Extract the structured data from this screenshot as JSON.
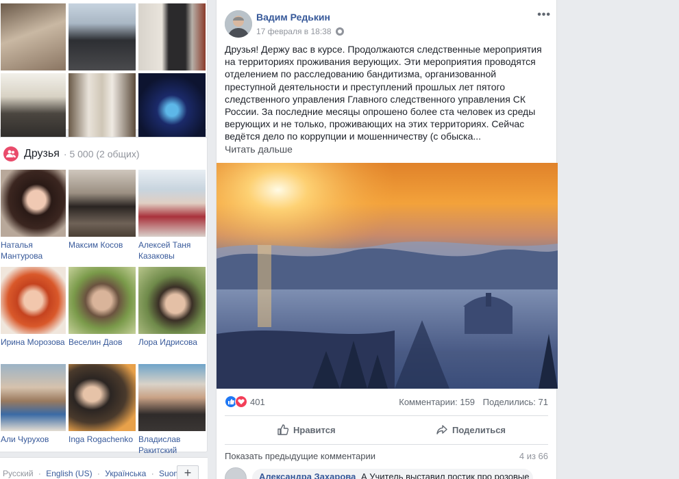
{
  "photos": {
    "tiles": [
      "photo-dinner",
      "photo-group",
      "photo-church-man",
      "photo-hall",
      "photo-two-men",
      "photo-stage"
    ]
  },
  "friends": {
    "title": "Друзья",
    "count": "· 5 000 (2 общих)",
    "items": [
      {
        "name_line1": "Наталья",
        "name_line2": "Мантурова"
      },
      {
        "name_line1": "Максим Косов",
        "name_line2": ""
      },
      {
        "name_line1": "Алексей Таня",
        "name_line2": "Казаковы"
      },
      {
        "name_line1": "Ирина Морозова",
        "name_line2": ""
      },
      {
        "name_line1": "Веселин Даов",
        "name_line2": ""
      },
      {
        "name_line1": "Лора Идрисова",
        "name_line2": ""
      },
      {
        "name_line1": "Али Чурухов",
        "name_line2": ""
      },
      {
        "name_line1": "Inga Rogachenko",
        "name_line2": ""
      },
      {
        "name_line1": "Владислав",
        "name_line2": "Ракитский"
      }
    ]
  },
  "languages": {
    "items": [
      "Русский",
      "·",
      "English (US)",
      "·",
      "Українська",
      "·",
      "Suomi"
    ],
    "add_label": "+"
  },
  "post": {
    "author": "Вадим Редькин",
    "date": "17 февраля в 18:38",
    "menu_icon": "•••",
    "text": "Друзья! Держу вас в курсе. Продолжаются следственные мероприятия на территориях проживания верующих. Эти мероприятия проводятся отделением по расследованию бандитизма, организованной преступной деятельности и преступлений прошлых лет пятого следственного управления Главного следственного управления СК России. За последние месяцы опрошено более ста человек из среды верующих и не только, проживающих на этих территориях. Сейчас ведётся дело по коррупции и мошенничеству (с обыска...",
    "read_more": "Читать дальше",
    "reactions_count": "401",
    "comments": "Комментарии: 159",
    "shares": "Поделились: 71",
    "like_label": "Нравится",
    "share_label": "Поделиться",
    "show_previous": "Показать предыдущие комментарии",
    "page_of": "4 из 66",
    "comment": {
      "author": "Александра Захарова",
      "text": "А Учитель выставил постик про розовые"
    }
  },
  "colors": {
    "link": "#365899",
    "like": "#2078f4",
    "love": "#f33e58",
    "friends_icon": "#e94b6b"
  }
}
